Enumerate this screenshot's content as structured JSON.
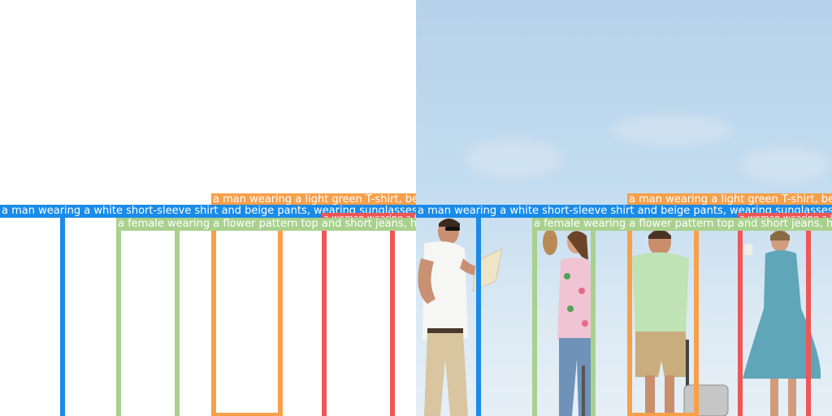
{
  "labels": {
    "man_white_shirt": "a man wearing a white short-sleeve shirt and beige pants, wearing sunglasses and holding a map",
    "man_green_tshirt": "a man wearing a light green T-shirt, beige shorts, pulling a suitcase",
    "female_flower": "a female wearing a flower pattern top and short jeans, holding a hat",
    "woman_blue_dress": "a woman wearing a blue dress, holding a cup"
  },
  "colors": {
    "man_white_shirt": "#1a8be8",
    "man_green_tshirt": "#f7a04a",
    "female_flower": "#a9d18e",
    "woman_blue_dress": "#ef5656"
  }
}
